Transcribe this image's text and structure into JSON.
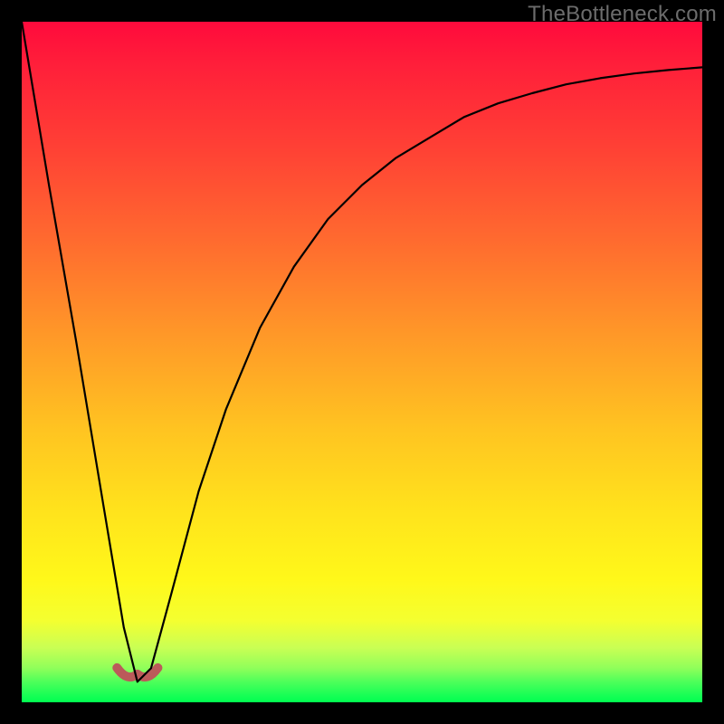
{
  "watermark": "TheBottleneck.com",
  "chart_data": {
    "type": "line",
    "title": "",
    "xlabel": "",
    "ylabel": "",
    "xlim": [
      0,
      100
    ],
    "ylim": [
      0,
      100
    ],
    "minimum_x": 17,
    "series": [
      {
        "name": "bottleneck-curve",
        "x": [
          0,
          4,
          8,
          12,
          15,
          17,
          19,
          22,
          26,
          30,
          35,
          40,
          45,
          50,
          55,
          60,
          65,
          70,
          75,
          80,
          85,
          90,
          95,
          100
        ],
        "values": [
          100,
          76,
          53,
          29,
          11,
          3,
          5,
          16,
          31,
          43,
          55,
          64,
          71,
          76,
          80,
          83,
          86,
          88,
          89.5,
          90.8,
          91.7,
          92.4,
          92.9,
          93.3
        ]
      }
    ],
    "marker": {
      "name": "optimal-zone",
      "x_range": [
        14,
        20
      ],
      "y": 4
    },
    "gradient_stops": [
      {
        "pct": 0,
        "color": "#ff0a3c"
      },
      {
        "pct": 18,
        "color": "#ff3f35"
      },
      {
        "pct": 46,
        "color": "#ff9828"
      },
      {
        "pct": 72,
        "color": "#ffe31c"
      },
      {
        "pct": 92,
        "color": "#c9ff54"
      },
      {
        "pct": 100,
        "color": "#00ff50"
      }
    ]
  }
}
